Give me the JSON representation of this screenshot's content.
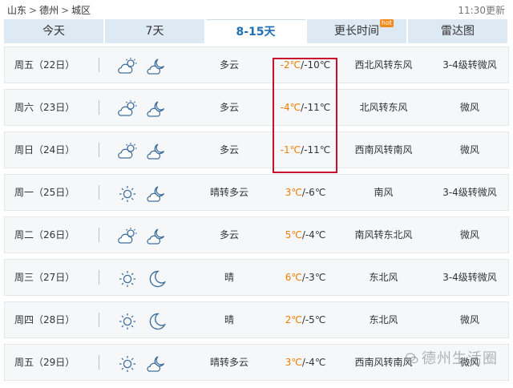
{
  "breadcrumb": [
    "山东",
    "德州",
    "城区"
  ],
  "breadcrumb_sep": ">",
  "update_time": "11:30更新",
  "tabs": [
    {
      "label": "今天",
      "active": false
    },
    {
      "label": "7天",
      "active": false
    },
    {
      "label": "8-15天",
      "active": true
    },
    {
      "label": "更长时间",
      "active": false,
      "badge": "hot"
    },
    {
      "label": "雷达图",
      "active": false
    }
  ],
  "days": [
    {
      "date": "周五（22日）",
      "icons": [
        "cloudy-sun-icon",
        "night-cloud-icon"
      ],
      "condition": "多云",
      "high": "-2℃",
      "low": "/-10℃",
      "wind": "西北风转东风",
      "level": "3-4级转微风"
    },
    {
      "date": "周六（23日）",
      "icons": [
        "cloudy-sun-icon",
        "night-cloud-icon"
      ],
      "condition": "多云",
      "high": "-4℃",
      "low": "/-11℃",
      "wind": "北风转东风",
      "level": "微风"
    },
    {
      "date": "周日（24日）",
      "icons": [
        "cloudy-sun-icon",
        "night-cloud-icon"
      ],
      "condition": "多云",
      "high": "-1℃",
      "low": "/-11℃",
      "wind": "西南风转南风",
      "level": "微风"
    },
    {
      "date": "周一（25日）",
      "icons": [
        "sun-icon",
        "night-cloud-icon"
      ],
      "condition": "晴转多云",
      "high": "3℃",
      "low": "/-6℃",
      "wind": "南风",
      "level": "3-4级转微风"
    },
    {
      "date": "周二（26日）",
      "icons": [
        "cloudy-sun-icon",
        "night-cloud-icon"
      ],
      "condition": "多云",
      "high": "5℃",
      "low": "/-4℃",
      "wind": "南风转东北风",
      "level": "微风"
    },
    {
      "date": "周三（27日）",
      "icons": [
        "sun-icon",
        "moon-icon"
      ],
      "condition": "晴",
      "high": "6℃",
      "low": "/-3℃",
      "wind": "东北风",
      "level": "3-4级转微风"
    },
    {
      "date": "周四（28日）",
      "icons": [
        "sun-icon",
        "moon-icon"
      ],
      "condition": "晴",
      "high": "2℃",
      "low": "/-5℃",
      "wind": "东北风",
      "level": "微风"
    },
    {
      "date": "周五（29日）",
      "icons": [
        "sun-icon",
        "night-cloud-icon"
      ],
      "condition": "晴转多云",
      "high": "3℃",
      "low": "/-4℃",
      "wind": "西南风转南风",
      "level": "微风"
    }
  ],
  "watermark": "德州生活圈",
  "colors": {
    "tab_bg": "#dde9f3",
    "active_tab_text": "#1f6fb4",
    "high_temp": "#ef7d00",
    "highlight": "#c8102e",
    "icon": "#3f6f9e",
    "sun": "#f0a30a"
  }
}
